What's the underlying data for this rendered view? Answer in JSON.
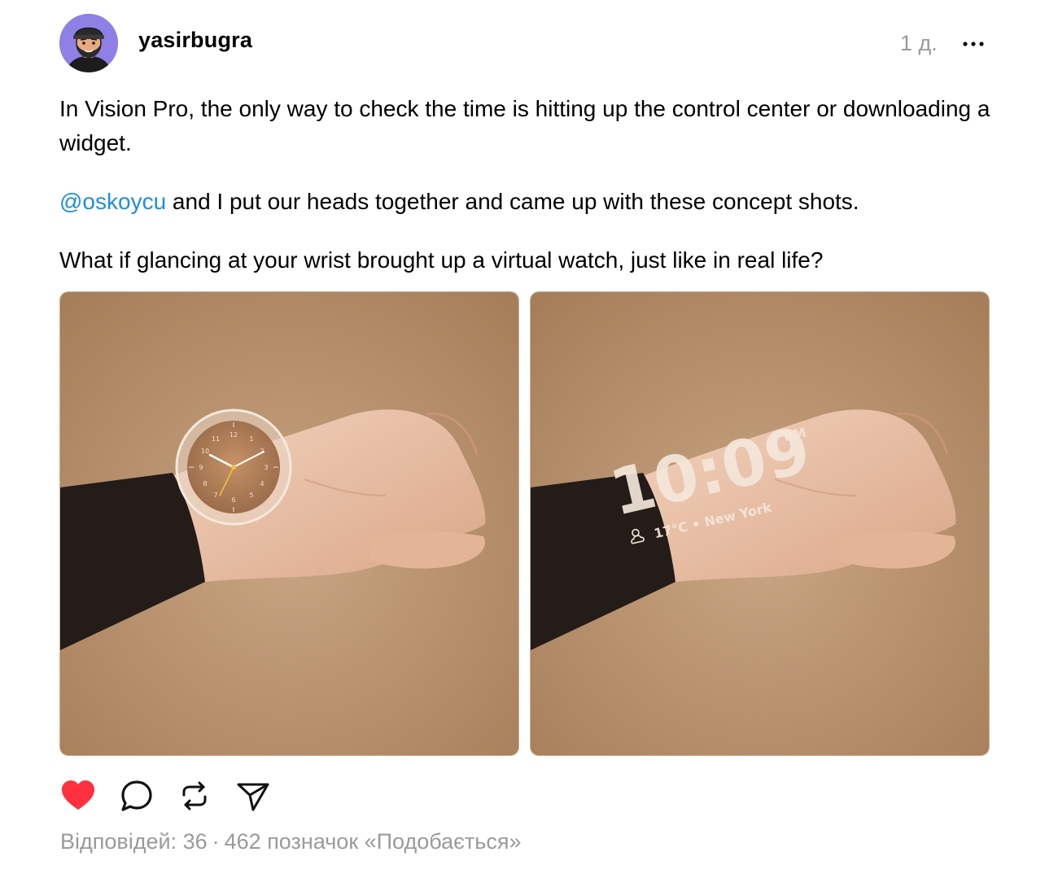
{
  "post": {
    "author": {
      "username": "yasirbugra"
    },
    "timestamp": "1 д.",
    "more_icon": "more-horizontal-icon",
    "text": {
      "p1": "In Vision Pro, the only way to check the time is hitting up the control center or downloading a widget.",
      "p2_mention": "@oskoycu",
      "p2_rest": " and I put our heads together and came up with these concept shots.",
      "p3": "What if glancing at your wrist brought up a virtual watch, just like in real life?"
    },
    "media": [
      {
        "kind": "analog-watch-concept",
        "dial_numbers": [
          "12",
          "1",
          "2",
          "3",
          "4",
          "5",
          "6",
          "7",
          "8",
          "9",
          "10",
          "11"
        ]
      },
      {
        "kind": "digital-watch-concept",
        "time": "10:09",
        "ampm": "PM",
        "weather": "17°C • New York",
        "weather_icon": "partly-cloudy-icon"
      }
    ],
    "actions": {
      "like_icon": "heart-filled-icon",
      "reply_icon": "speech-bubble-icon",
      "repost_icon": "repost-icon",
      "share_icon": "send-icon",
      "liked": true
    },
    "stats": {
      "replies": "Відповідей: 36",
      "separator": "·",
      "likes": "462 позначок «Подобається»"
    },
    "colors": {
      "mention": "#1d8fe0",
      "like": "#ff3040",
      "meta_text": "#9a9a9a",
      "avatar_bg": "#8f80e6",
      "photo_bg": "#b88f6a"
    }
  }
}
